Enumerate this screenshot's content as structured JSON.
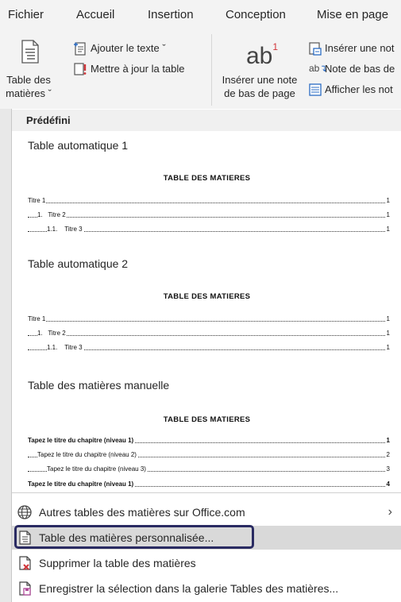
{
  "ribbon": {
    "tabs": [
      "Fichier",
      "Accueil",
      "Insertion",
      "Conception",
      "Mise en page"
    ],
    "toc_button": {
      "line1": "Table des",
      "line2": "matières ˇ"
    },
    "add_text": "Ajouter le texte ˇ",
    "update_table": "Mettre à jour la table",
    "insert_footnote": {
      "line1": "Insérer une note",
      "line2": "de bas de page",
      "glyph": "ab",
      "sup": "1"
    },
    "insert_endnote": "Insérer une not",
    "next_footnote": "Note de bas de",
    "show_notes": "Afficher les not"
  },
  "dropdown": {
    "section_title": "Prédéfini",
    "groups": [
      {
        "title": "Table automatique 1",
        "heading": "TABLE DES MATIERES",
        "lines": [
          {
            "label": "Titre 1",
            "page": "1"
          },
          {
            "label": "1.   Titre 2",
            "page": "1"
          },
          {
            "label": "1.1.    Titre 3",
            "page": "1"
          }
        ]
      },
      {
        "title": "Table automatique 2",
        "heading": "TABLE DES MATIERES",
        "lines": [
          {
            "label": "Titre 1",
            "page": "1"
          },
          {
            "label": "1.   Titre 2",
            "page": "1"
          },
          {
            "label": "1.1.    Titre 3",
            "page": "1"
          }
        ]
      },
      {
        "title": "Table des matières manuelle",
        "heading": "TABLE DES MATIERES",
        "lines": [
          {
            "label": "Tapez le titre du chapitre (niveau 1)",
            "page": "1"
          },
          {
            "label": "Tapez le titre du chapitre (niveau 2)",
            "page": "2"
          },
          {
            "label": "Tapez le titre du chapitre (niveau 3)",
            "page": "3"
          },
          {
            "label": "Tapez le titre du chapitre (niveau 1)",
            "page": "4"
          }
        ]
      }
    ],
    "menu": [
      {
        "label": "Autres tables des matières sur Office.com",
        "icon": "globe-icon",
        "submenu": "›"
      },
      {
        "label": "Table des matières personnalisée...",
        "icon": "document-icon"
      },
      {
        "label": "Supprimer la table des matières",
        "icon": "delete-document-icon"
      },
      {
        "label": "Enregistrer la sélection dans la galerie Tables des matières...",
        "icon": "save-gallery-icon"
      }
    ]
  },
  "colors": {
    "ribbon_bg": "#f3f3f3",
    "highlight": "#d9d9d9",
    "focus_ring": "#2a2b62",
    "accent_blue": "#2b6cc4",
    "delete_red": "#d13438"
  }
}
